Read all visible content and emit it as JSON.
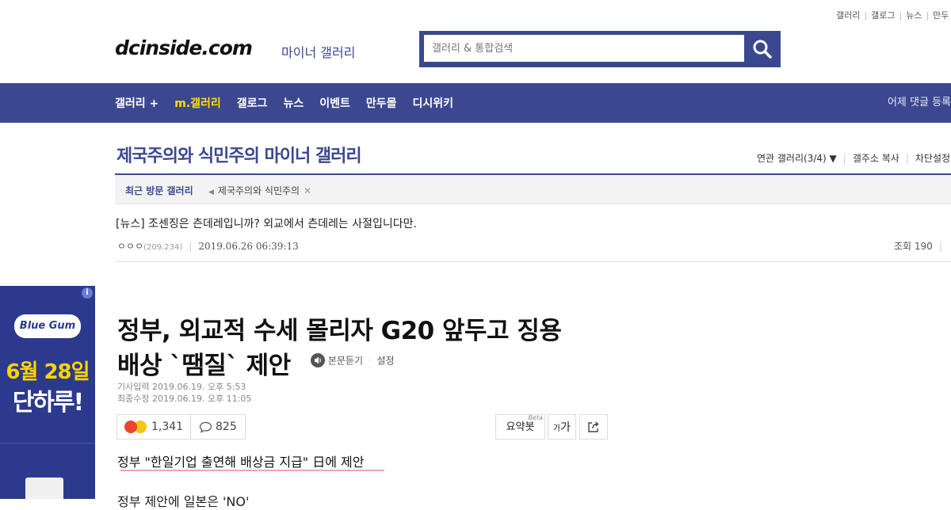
{
  "top_links": [
    "갤러리",
    "갤로그",
    "뉴스",
    "만두"
  ],
  "header": {
    "logo": "dcinside.com",
    "logo_sub": "마이너 갤러리",
    "search_placeholder": "갤러리 & 통합검색"
  },
  "nav": {
    "items": [
      "갤러리 +",
      "m.갤러리",
      "갤로그",
      "뉴스",
      "이벤트",
      "만두몰",
      "디시위키"
    ],
    "right_text": "어제 댓글 등록"
  },
  "gallery": {
    "title": "제국주의와 식민주의 마이너 갤러리",
    "related": "연관 갤러리(3/4)",
    "copy_addr": "갤주소 복사",
    "block": "차단설정",
    "recent_label": "최근 방문 갤러리",
    "recent_item": "제국주의와 식민주의"
  },
  "post": {
    "title": "[뉴스] 조센징은 츤데레입니까? 외교에서 츤데레는 사절입니다만.",
    "author": "ㅇㅇㅇ",
    "ip": "(209.234)",
    "datetime": "2019.06.26 06:39:13",
    "views": "조회 190"
  },
  "ad": {
    "brand": "Blue Gum",
    "date_text": "6월 28일",
    "sub_text": "단하루!",
    "info": "i"
  },
  "article": {
    "title_line1": "정부, 외교적 수세 몰리자 G20 앞두고 징용",
    "title_line2": "배상 `땜질` 제안",
    "tts_label": "본문듣기",
    "tts_settings": "설정",
    "date_input": "기사입력  2019.06.19. 오후 5:53",
    "date_modified": "최종수정  2019.06.19. 오후 11:05",
    "reaction_count": "1,341",
    "comment_count": "825",
    "summary_label": "요약봇",
    "summary_badge": "Beta",
    "font_label": "가",
    "subhead": "정부 \"한일기업 출연해 배상금 지급\" 日에 제안",
    "body_preview": "정부 제안에 일본은 'NO'"
  },
  "colors": {
    "brand": "#3b4890",
    "nav_active": "#ffe200",
    "underline": "#f4a5a5"
  }
}
